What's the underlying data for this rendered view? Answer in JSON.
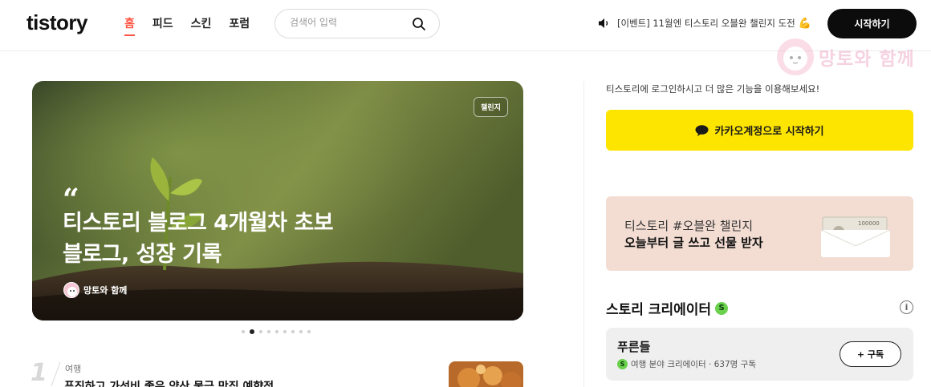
{
  "header": {
    "logo": "tistory",
    "nav": [
      {
        "label": "홈",
        "active": true
      },
      {
        "label": "피드",
        "active": false
      },
      {
        "label": "스킨",
        "active": false
      },
      {
        "label": "포럼",
        "active": false
      }
    ],
    "search": {
      "placeholder": "검색어 입력",
      "icon": "search-icon"
    },
    "notice": {
      "text": "[이벤트] 11월엔 티스토리 오블완 챌린지 도전",
      "emoji": "💪"
    },
    "start_label": "시작하기"
  },
  "watermark": {
    "text": "망토와 함께"
  },
  "hero": {
    "badge": "챌린지",
    "quote_mark": "“",
    "title": "티스토리 블로그 4개월차 초보 블로그, 성장 기록",
    "author": "망토와 함께",
    "dots_total": 9,
    "dots_active_index": 1
  },
  "ranking": {
    "number": "1",
    "category": "여행",
    "title": "푸짐하고 가성비 좋은 양산 물금 맛집 예향정"
  },
  "sidebar": {
    "login_text": "티스토리에 로그인하시고 더 많은 기능을 이용해보세요!",
    "kakao_label": "카카오계정으로 시작하기",
    "banner": {
      "sub": "티스토리 #오블완 챌린지",
      "main": "오늘부터 글 쓰고 선물 받자",
      "bill_amount": "100000"
    },
    "creators_title": "스토리 크리에이터",
    "s_badge": "S",
    "info_icon_text": "i",
    "creator": {
      "name": "푸른들",
      "meta": "여행 분야 크리에이터 · 637명 구독",
      "subscribe_label": "+ 구독"
    }
  },
  "colors": {
    "accent": "#ff5544",
    "kakao": "#fee500",
    "banner_bg": "#f3ddd3",
    "creator_badge": "#6ad14d"
  }
}
